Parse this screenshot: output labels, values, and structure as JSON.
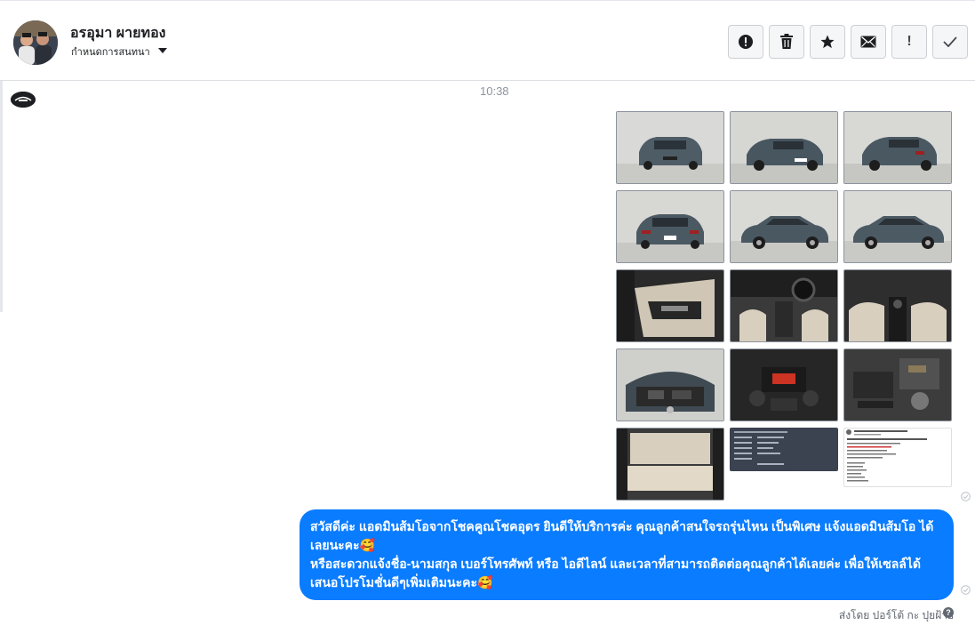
{
  "header": {
    "contact_name": "อรอุมา ผายทอง",
    "assign_label": "กำหนดการสนทนา",
    "actions": [
      {
        "name": "mark-spam-button",
        "icon": "alert-circle-icon",
        "glyph": "!"
      },
      {
        "name": "delete-button",
        "icon": "trash-icon",
        "glyph": ""
      },
      {
        "name": "star-button",
        "icon": "star-icon",
        "glyph": "★"
      },
      {
        "name": "mark-unread-button",
        "icon": "envelope-icon",
        "glyph": ""
      },
      {
        "name": "follow-up-button",
        "icon": "exclamation-icon",
        "glyph": "!"
      },
      {
        "name": "mark-done-button",
        "icon": "check-icon",
        "glyph": "✓"
      }
    ]
  },
  "conversation": {
    "timestamp": "10:38",
    "photos": [
      {
        "icon": "car-front-photo",
        "scene": "car-front"
      },
      {
        "icon": "car-front-angle-photo",
        "scene": "car-front"
      },
      {
        "icon": "car-rear-angle-photo",
        "scene": "car-rear"
      },
      {
        "icon": "car-rear-photo",
        "scene": "car-rear"
      },
      {
        "icon": "car-side-photo",
        "scene": "car-side"
      },
      {
        "icon": "car-side-photo",
        "scene": "car-side"
      },
      {
        "icon": "door-panel-photo",
        "scene": "interior"
      },
      {
        "icon": "dashboard-photo",
        "scene": "interior"
      },
      {
        "icon": "front-seats-photo",
        "scene": "interior"
      },
      {
        "icon": "engine-bay-photo",
        "scene": "engine"
      },
      {
        "icon": "console-photo",
        "scene": "interior-dark"
      },
      {
        "icon": "engine-detail-photo",
        "scene": "engine"
      },
      {
        "icon": "rear-seat-photo",
        "scene": "interior"
      },
      {
        "icon": "spec-sheet-screenshot",
        "scene": "dark-doc"
      },
      {
        "icon": "post-screenshot",
        "scene": "light-doc"
      }
    ],
    "message_lines": [
      "สวัสดีค่ะ แอดมินส้มโอจากโชคคูณโชคอุดร ยินดีให้บริการค่ะ   คุณลูกค้าสนใจรถรุ่นไหน เป็นพิเศษ แจ้งแอดมินส้มโอ ได้เลยนะคะ🥰",
      "หรือสะดวกแจ้งชื่อ-นามสกุล เบอร์โทรศัพท์ หรือ ไอดีไลน์ และเวลาที่สามารถติดต่อคุณลูกค้าได้เลยค่ะ เพื่อให้เซลล์ได้เสนอโปรโมชั่นดีๆเพิ่มเติมนะคะ🥰"
    ],
    "sent_by": "ส่งโดย ปอร์โต้ กะ ปุยฝ้าย",
    "help_glyph": "?"
  },
  "colors": {
    "bubble": "#0a7cff",
    "border": "#dddfe2",
    "muted_text": "#8d949e"
  }
}
